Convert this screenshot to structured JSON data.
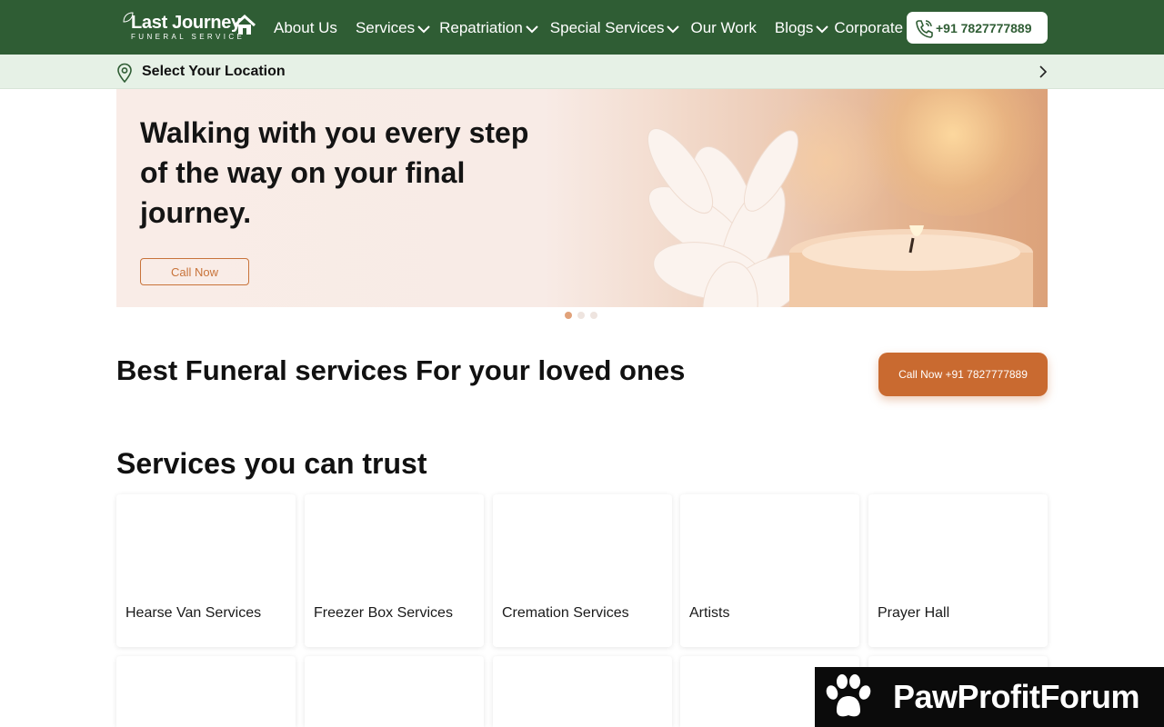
{
  "header": {
    "logo_text": "Last Journey",
    "logo_subtext": "FUNERAL SERVICE",
    "nav": [
      {
        "label": "About Us",
        "dropdown": false
      },
      {
        "label": "Services",
        "dropdown": true
      },
      {
        "label": "Repatriation",
        "dropdown": true
      },
      {
        "label": "Special Services",
        "dropdown": true
      },
      {
        "label": "Our Work",
        "dropdown": false
      },
      {
        "label": "Blogs",
        "dropdown": true
      },
      {
        "label": "Corporate",
        "dropdown": false
      }
    ],
    "phone": "+91 7827777889"
  },
  "location_bar": {
    "label": "Select Your Location"
  },
  "hero": {
    "headline": "Walking with you every step of the way on your final journey.",
    "cta_label": "Call Now",
    "slides": 3,
    "active_slide": 1
  },
  "intro": {
    "headline": "Best Funeral services For your loved ones",
    "cta_label": "Call Now +91 7827777889"
  },
  "services": {
    "title": "Services you can trust",
    "cards": [
      {
        "label": "Hearse Van Services"
      },
      {
        "label": "Freezer Box Services"
      },
      {
        "label": "Cremation Services"
      },
      {
        "label": "Artists"
      },
      {
        "label": "Prayer Hall"
      }
    ]
  },
  "watermark": {
    "text": "PawProfitForum"
  },
  "colors": {
    "nav_bg": "#2f5d34",
    "location_bg": "#e6f1e6",
    "accent": "#c96a30"
  }
}
